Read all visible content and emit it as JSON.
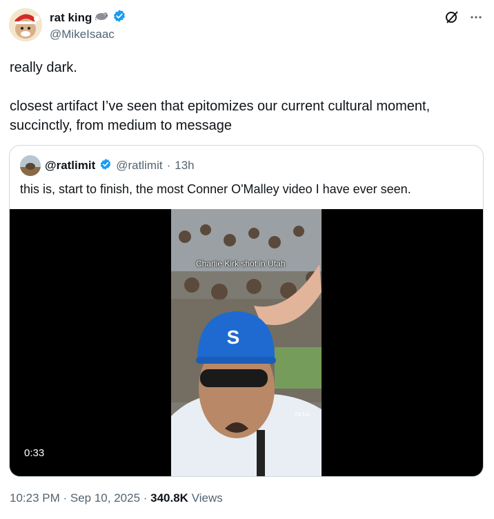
{
  "author": {
    "display_name": "rat king",
    "handle": "@MikeIsaac"
  },
  "tweet": {
    "text": "really dark.\n\nclosest artifact I’ve seen that epitomizes our current cultural moment, succinctly, from medium to message"
  },
  "quoted": {
    "display_name": "@ratlimit",
    "handle": "@ratlimit",
    "separator": "·",
    "time": "13h",
    "text": "this is, start to finish, the most Conner O'Malley video I have ever seen.",
    "video": {
      "caption": "Charlie Kirk shot in Utah",
      "duration": "0:33",
      "watermark": "TikTok"
    }
  },
  "meta": {
    "time": "10:23 PM",
    "sep1": " · ",
    "date": "Sep 10, 2025",
    "sep2": " · ",
    "views_count": "340.8K",
    "views_label": " Views"
  },
  "colors": {
    "verified": "#1d9bf0",
    "secondary_text": "#536471",
    "border": "#cfd9de"
  },
  "icons": [
    "grok-icon",
    "more-icon",
    "verified-badge-icon",
    "rat-emoji-icon"
  ]
}
